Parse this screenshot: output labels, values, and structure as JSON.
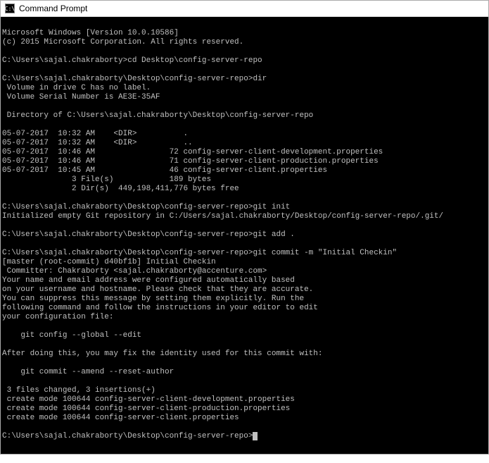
{
  "titlebar": {
    "icon_label": "C:\\",
    "title": "Command Prompt"
  },
  "lines": [
    "",
    "Microsoft Windows [Version 10.0.10586]",
    "(c) 2015 Microsoft Corporation. All rights reserved.",
    "",
    "C:\\Users\\sajal.chakraborty>cd Desktop\\config-server-repo",
    "",
    "C:\\Users\\sajal.chakraborty\\Desktop\\config-server-repo>dir",
    " Volume in drive C has no label.",
    " Volume Serial Number is AE3E-35AF",
    "",
    " Directory of C:\\Users\\sajal.chakraborty\\Desktop\\config-server-repo",
    "",
    "05-07-2017  10:32 AM    <DIR>          .",
    "05-07-2017  10:32 AM    <DIR>          ..",
    "05-07-2017  10:46 AM                72 config-server-client-development.properties",
    "05-07-2017  10:46 AM                71 config-server-client-production.properties",
    "05-07-2017  10:45 AM                46 config-server-client.properties",
    "               3 File(s)            189 bytes",
    "               2 Dir(s)  449,198,411,776 bytes free",
    "",
    "C:\\Users\\sajal.chakraborty\\Desktop\\config-server-repo>git init",
    "Initialized empty Git repository in C:/Users/sajal.chakraborty/Desktop/config-server-repo/.git/",
    "",
    "C:\\Users\\sajal.chakraborty\\Desktop\\config-server-repo>git add .",
    "",
    "C:\\Users\\sajal.chakraborty\\Desktop\\config-server-repo>git commit -m \"Initial Checkin\"",
    "[master (root-commit) d40bf1b] Initial Checkin",
    " Committer: Chakraborty <sajal.chakraborty@accenture.com>",
    "Your name and email address were configured automatically based",
    "on your username and hostname. Please check that they are accurate.",
    "You can suppress this message by setting them explicitly. Run the",
    "following command and follow the instructions in your editor to edit",
    "your configuration file:",
    "",
    "    git config --global --edit",
    "",
    "After doing this, you may fix the identity used for this commit with:",
    "",
    "    git commit --amend --reset-author",
    "",
    " 3 files changed, 3 insertions(+)",
    " create mode 100644 config-server-client-development.properties",
    " create mode 100644 config-server-client-production.properties",
    " create mode 100644 config-server-client.properties",
    "",
    "C:\\Users\\sajal.chakraborty\\Desktop\\config-server-repo>"
  ]
}
